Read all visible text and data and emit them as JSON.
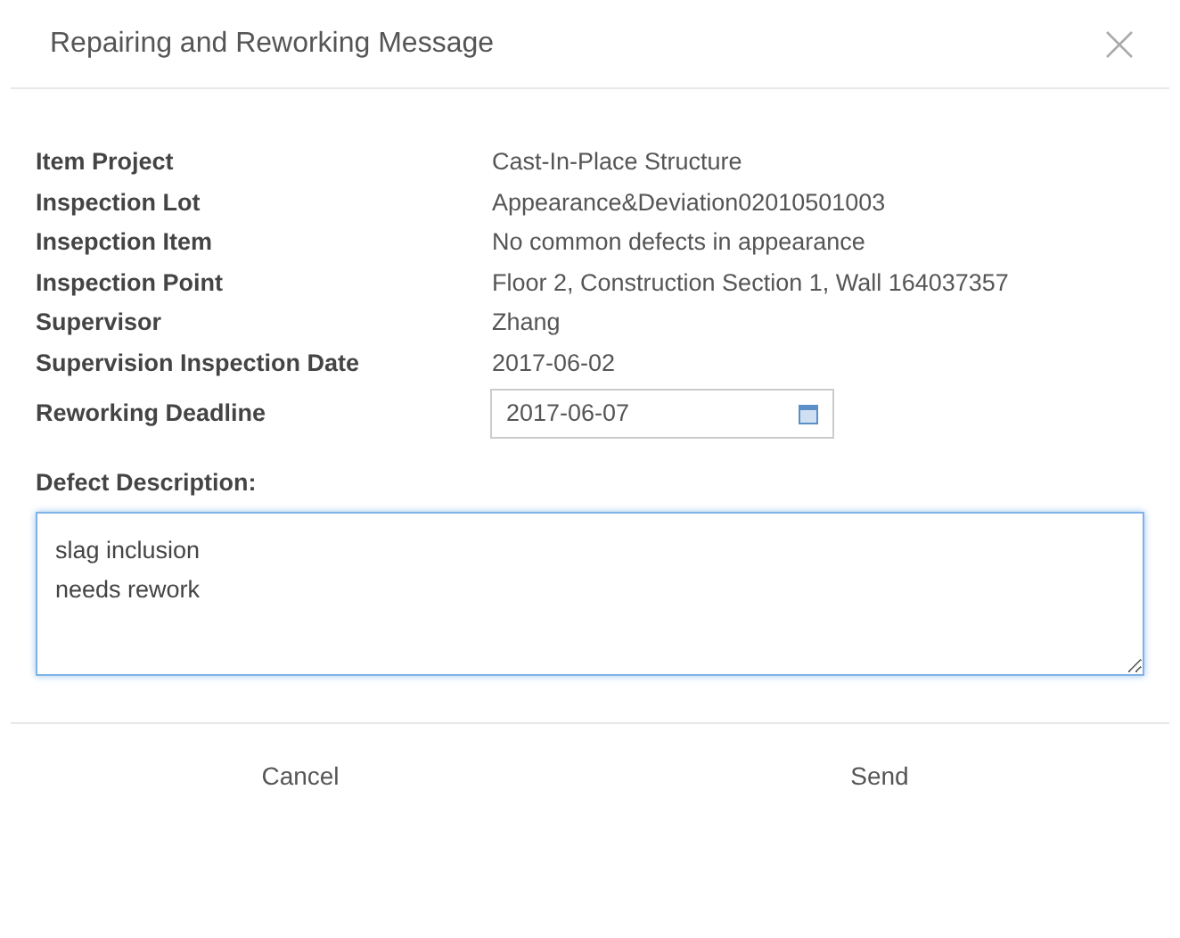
{
  "dialog": {
    "title": "Repairing and Reworking Message"
  },
  "fields": [
    {
      "label": "Item Project",
      "value": "Cast-In-Place Structure"
    },
    {
      "label": "Inspection Lot",
      "value": "Appearance&Deviation02010501003"
    },
    {
      "label": "Insepction Item",
      "value": "No common defects in appearance"
    },
    {
      "label": "Inspection Point",
      "value": "Floor 2, Construction Section 1, Wall 164037357"
    },
    {
      "label": "Supervisor",
      "value": "Zhang"
    },
    {
      "label": "Supervision Inspection Date",
      "value": "2017-06-02"
    }
  ],
  "deadline": {
    "label": "Reworking Deadline",
    "value": "2017-06-07"
  },
  "defect": {
    "label": "Defect Description:",
    "value": "slag inclusion\nneeds rework"
  },
  "buttons": [
    "Cancel",
    "Send"
  ]
}
